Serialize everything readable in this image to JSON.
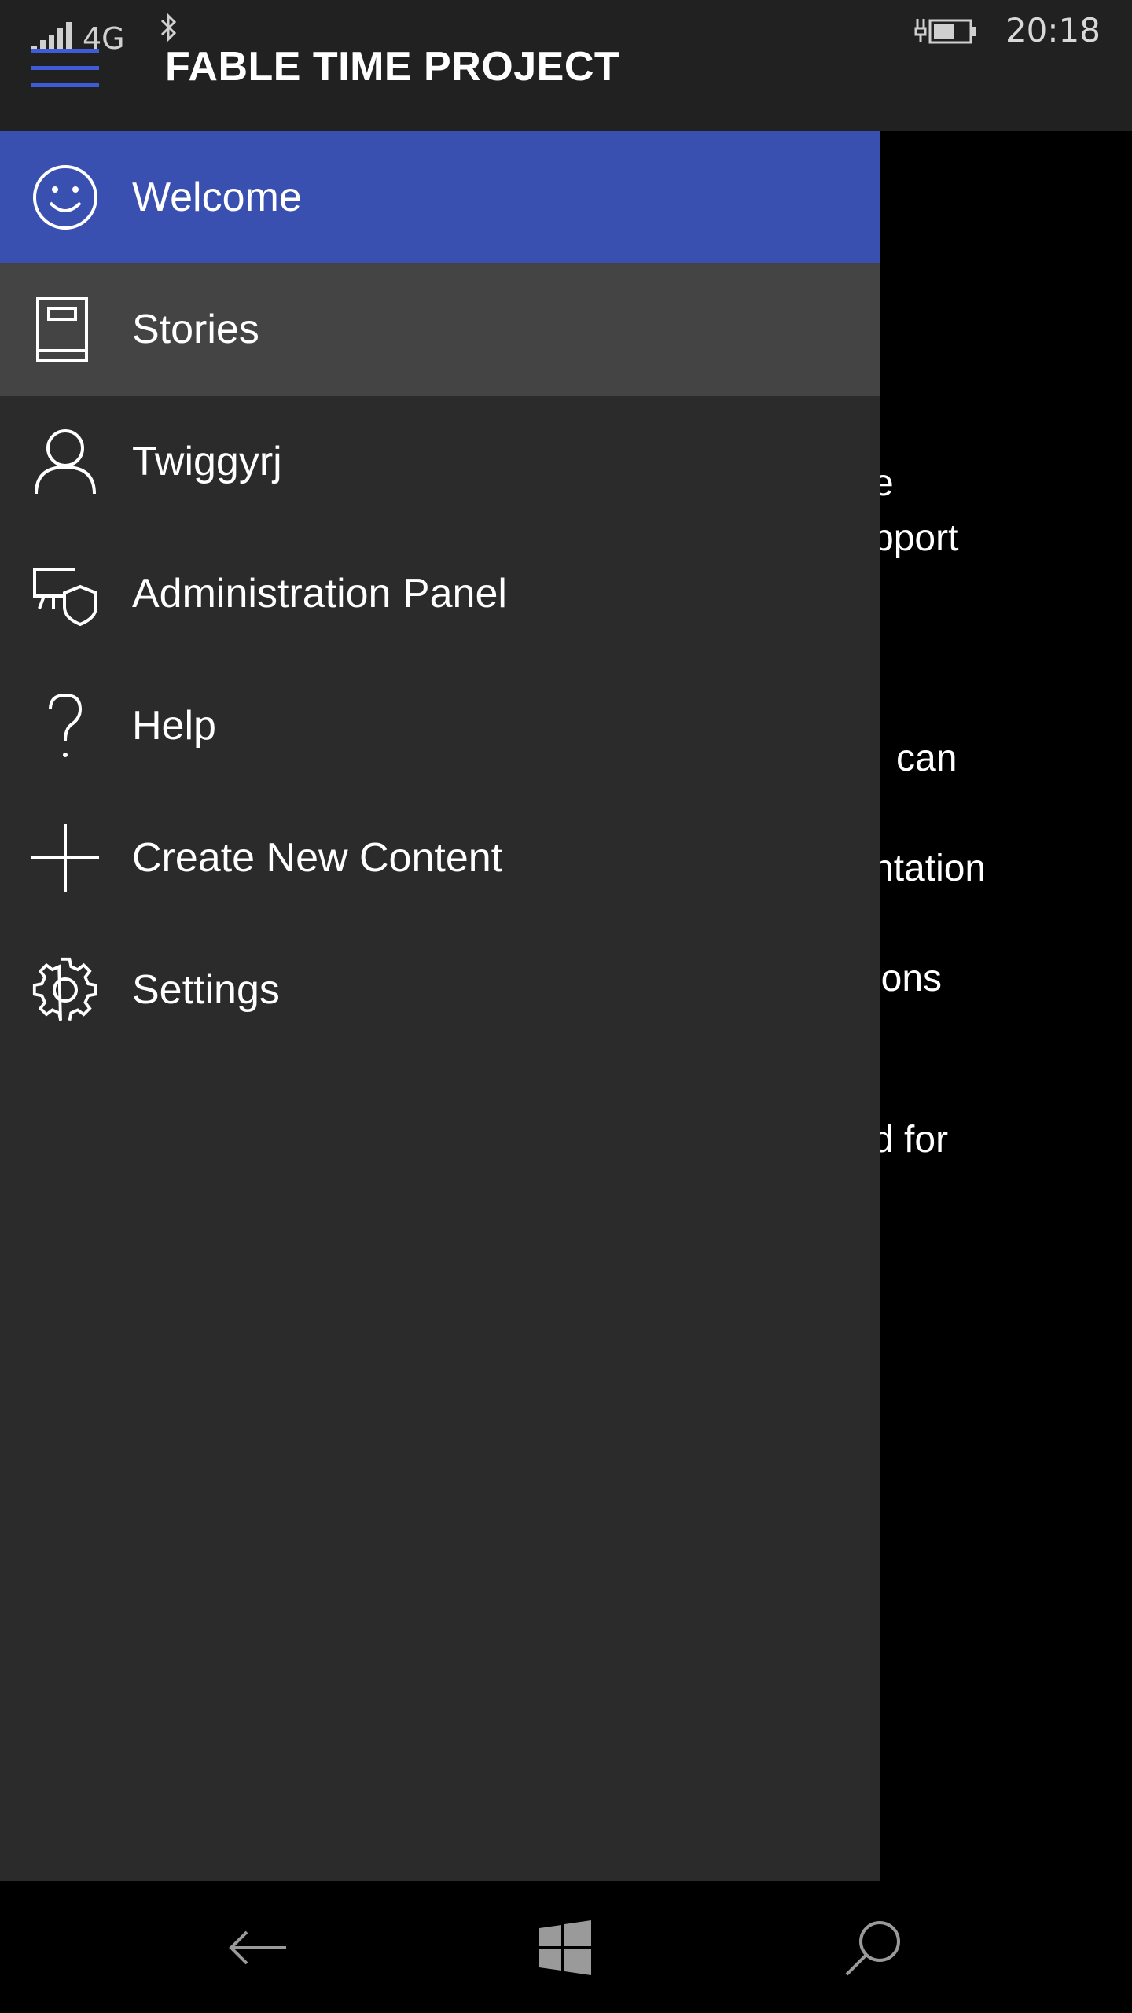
{
  "status_bar": {
    "network": "4G",
    "time": "20:18"
  },
  "header": {
    "title": "FABLE TIME PROJECT",
    "accent_color": "#3f5bd6"
  },
  "drawer": {
    "items": [
      {
        "label": "Welcome",
        "icon": "smiley-icon",
        "state": "selected"
      },
      {
        "label": "Stories",
        "icon": "book-icon",
        "state": "hover"
      },
      {
        "label": "Twiggyrj",
        "icon": "person-icon",
        "state": "normal"
      },
      {
        "label": "Administration Panel",
        "icon": "admin-shield-icon",
        "state": "normal"
      },
      {
        "label": "Help",
        "icon": "question-icon",
        "state": "normal"
      },
      {
        "label": "Create New Content",
        "icon": "plus-icon",
        "state": "normal"
      },
      {
        "label": "Settings",
        "icon": "gear-icon",
        "state": "normal"
      }
    ]
  },
  "background_content": {
    "lines": [
      "e",
      "pport",
      "can",
      "ntation",
      "ions",
      "d for"
    ]
  },
  "bottom_nav": {
    "icons": [
      "back-arrow-icon",
      "windows-start-icon",
      "search-icon"
    ]
  }
}
